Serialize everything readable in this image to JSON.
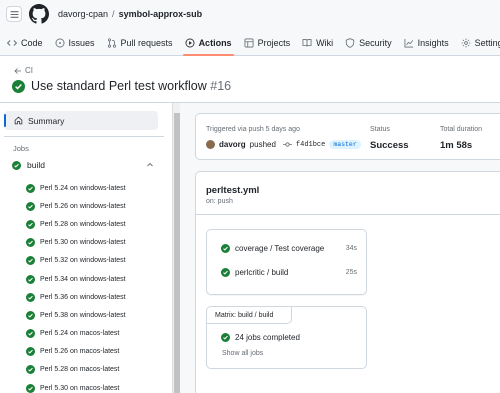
{
  "header": {
    "owner": "davorg-cpan",
    "separator": "/",
    "repo": "symbol-approx-sub"
  },
  "tabs": [
    {
      "label": "Code",
      "icon": "code-icon"
    },
    {
      "label": "Issues",
      "icon": "issue-icon"
    },
    {
      "label": "Pull requests",
      "icon": "pull-request-icon"
    },
    {
      "label": "Actions",
      "icon": "play-icon",
      "active": true
    },
    {
      "label": "Projects",
      "icon": "table-icon"
    },
    {
      "label": "Wiki",
      "icon": "book-icon"
    },
    {
      "label": "Security",
      "icon": "shield-icon"
    },
    {
      "label": "Insights",
      "icon": "graph-icon"
    },
    {
      "label": "Settings",
      "icon": "gear-icon"
    }
  ],
  "run": {
    "back_label": "CI",
    "title": "Use standard Perl test workflow",
    "number": "#16"
  },
  "sidebar": {
    "summary_label": "Summary",
    "jobs_heading": "Jobs",
    "group_label": "build",
    "jobs": [
      "Perl 5.24 on windows-latest",
      "Perl 5.26 on windows-latest",
      "Perl 5.28 on windows-latest",
      "Perl 5.30 on windows-latest",
      "Perl 5.32 on windows-latest",
      "Perl 5.34 on windows-latest",
      "Perl 5.36 on windows-latest",
      "Perl 5.38 on windows-latest",
      "Perl 5.24 on macos-latest",
      "Perl 5.26 on macos-latest",
      "Perl 5.28 on macos-latest",
      "Perl 5.30 on macos-latest"
    ]
  },
  "summary": {
    "triggered": "Triggered via push 5 days ago",
    "user": "davorg",
    "action": "pushed",
    "sha": "f4d1bce",
    "branch": "master",
    "status_label": "Status",
    "status_value": "Success",
    "duration_label": "Total duration",
    "duration_value": "1m 58s"
  },
  "workflow": {
    "file": "perltest.yml",
    "trigger": "on: push",
    "jobs": [
      {
        "name": "coverage / Test coverage",
        "duration": "34s"
      },
      {
        "name": "perlcritic / build",
        "duration": "25s"
      }
    ],
    "matrix": {
      "title": "Matrix: build / build",
      "completed": "24 jobs completed",
      "show_all": "Show all jobs"
    }
  },
  "colors": {
    "success": "#1a7f37",
    "accent": "#0969da",
    "tab_underline": "#fd8c73"
  }
}
